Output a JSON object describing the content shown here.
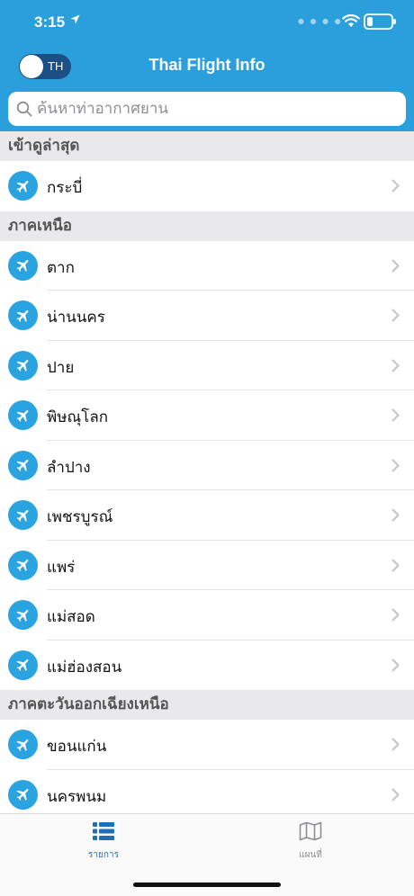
{
  "status": {
    "time": "3:15"
  },
  "header": {
    "title": "Thai Flight Info",
    "toggle_label": "TH"
  },
  "search": {
    "placeholder": "ค้นหาท่าอากาศยาน"
  },
  "sections": [
    {
      "title": "เข้าดูล่าสุด",
      "items": [
        "กระบี่"
      ]
    },
    {
      "title": "ภาคเหนือ",
      "items": [
        "ตาก",
        "น่านนคร",
        "ปาย",
        "พิษณุโลก",
        "ลำปาง",
        "เพชรบูรณ์",
        "แพร่",
        "แม่สอด",
        "แม่ฮ่องสอน"
      ]
    },
    {
      "title": "ภาคตะวันออกเฉียงเหนือ",
      "items": [
        "ขอนแก่น",
        "นครพนม"
      ]
    }
  ],
  "tabs": [
    {
      "label": "รายการ",
      "icon": "list-icon",
      "active": true
    },
    {
      "label": "แผนที่",
      "icon": "map-icon",
      "active": false
    }
  ],
  "colors": {
    "accent": "#2a9fdc",
    "pin": "#2aa4e0",
    "tab_active": "#1d6fb8"
  }
}
